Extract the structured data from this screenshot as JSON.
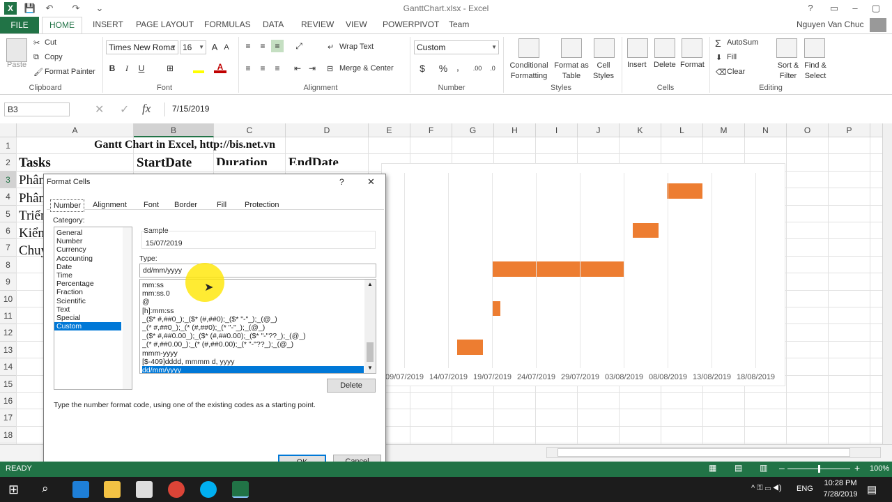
{
  "window": {
    "title": "GanttChart.xlsx - Excel",
    "user": "Nguyen Van Chuc"
  },
  "tabs": [
    "FILE",
    "HOME",
    "INSERT",
    "PAGE LAYOUT",
    "FORMULAS",
    "DATA",
    "REVIEW",
    "VIEW",
    "POWERPIVOT",
    "Team"
  ],
  "ribbon": {
    "clipboard": {
      "paste": "Paste",
      "cut": "Cut",
      "copy": "Copy",
      "painter": "Format Painter",
      "label": "Clipboard"
    },
    "font": {
      "name": "Times New Roma",
      "size": "16",
      "label": "Font",
      "bold": "B",
      "italic": "I",
      "underline": "U",
      "grow": "A",
      "shrink": "A"
    },
    "alignment": {
      "wrap": "Wrap Text",
      "merge": "Merge & Center",
      "label": "Alignment"
    },
    "number": {
      "format": "Custom",
      "label": "Number",
      "currency": "$",
      "percent": "%",
      "comma": ","
    },
    "styles": {
      "cond": "Conditional Formatting",
      "table": "Format as Table",
      "cell": "Cell Styles",
      "label": "Styles"
    },
    "cells": {
      "insert": "Insert",
      "delete": "Delete",
      "format": "Format",
      "label": "Cells"
    },
    "editing": {
      "autosum": "AutoSum",
      "fill": "Fill",
      "clear": "Clear",
      "sort": "Sort & Filter",
      "find": "Find & Select",
      "label": "Editing"
    }
  },
  "formula_bar": {
    "name_box": "B3",
    "value": "7/15/2019",
    "fx": "fx"
  },
  "columns": [
    "A",
    "B",
    "C",
    "D",
    "E",
    "F",
    "G",
    "H",
    "I",
    "J",
    "K",
    "L",
    "M",
    "N",
    "O",
    "P"
  ],
  "rows": [
    "1",
    "2",
    "3",
    "4",
    "5",
    "6",
    "7",
    "8",
    "9",
    "10",
    "11",
    "12",
    "13",
    "14",
    "15",
    "16",
    "17",
    "18"
  ],
  "cells": {
    "title": "Gantt Chart in Excel, http://bis.net.vn",
    "tasks": "Tasks",
    "start": "StartDate",
    "duration": "Duration",
    "end": "EndDate",
    "r3": "Phân",
    "r4": "Phân",
    "r5": "Triển",
    "r6": "Kiển",
    "r7": "Chuy"
  },
  "chart_data": {
    "type": "bar",
    "x_ticks": [
      "09/07/2019",
      "14/07/2019",
      "19/07/2019",
      "24/07/2019",
      "29/07/2019",
      "03/08/2019",
      "08/08/2019",
      "13/08/2019",
      "18/08/2019"
    ]
  },
  "dialog": {
    "title": "Format Cells",
    "help": "?",
    "close": "✕",
    "tabs": [
      "Number",
      "Alignment",
      "Font",
      "Border",
      "Fill",
      "Protection"
    ],
    "category_label": "Category:",
    "categories": [
      "General",
      "Number",
      "Currency",
      "Accounting",
      "Date",
      "Time",
      "Percentage",
      "Fraction",
      "Scientific",
      "Text",
      "Special",
      "Custom"
    ],
    "sample_label": "Sample",
    "sample_value": "15/07/2019",
    "type_label": "Type:",
    "type_value": "dd/mm/yyyy",
    "formats": [
      "mm:ss",
      "mm:ss.0",
      "@",
      "[h]:mm:ss",
      "_($* #,##0_);_($* (#,##0);_($* \"-\"_);_(@_)",
      "_(* #,##0_);_(* (#,##0);_(* \"-\"_);_(@_)",
      "_($* #,##0.00_);_($* (#,##0.00);_($* \"-\"??_);_(@_)",
      "_(* #,##0.00_);_(* (#,##0.00);_(* \"-\"??_);_(@_)",
      "mmm-yyyy",
      "[$-409]dddd, mmmm d, yyyy",
      "dd/mm/yyyy"
    ],
    "delete": "Delete",
    "hint": "Type the number format code, using one of the existing codes as a starting point.",
    "ok": "OK",
    "cancel": "Cancel"
  },
  "status": {
    "ready": "READY",
    "zoom": "100%"
  },
  "taskbar": {
    "time": "10:28 PM",
    "date": "7/28/2019",
    "lang": "ENG"
  }
}
